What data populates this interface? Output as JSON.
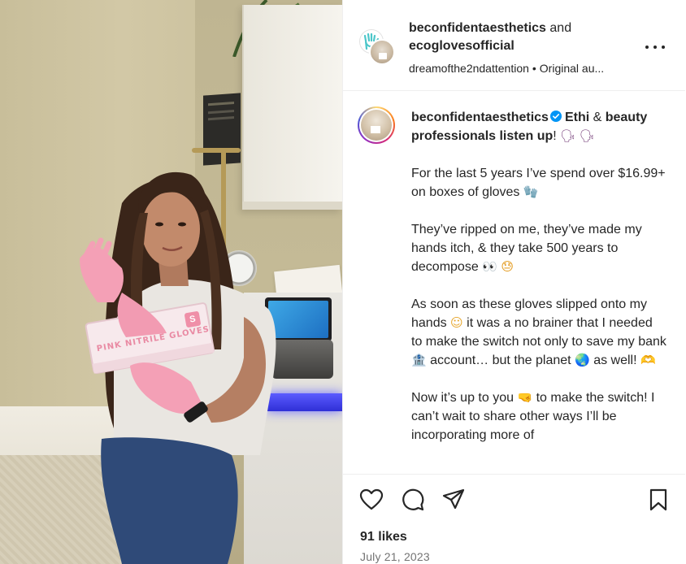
{
  "post": {
    "photo_alt": "Woman holding a box of pink nitrile gloves",
    "box_text": "PINK NITRILE GLOVES",
    "box_size": "S"
  },
  "header": {
    "author": "beconfidentaesthetics",
    "joiner": "and",
    "collaborator": "ecoglovesofficial",
    "audio_user": "dreamofthe2ndattention",
    "separator": "•",
    "audio_label": "Original au..."
  },
  "caption": {
    "username": "beconfidentaesthetics",
    "verified": true,
    "intro_bold": "Ethi",
    "intro_amp": " &",
    "intro_bold2": "beauty professionals listen up",
    "intro_end": "!",
    "emoji_speak": "🗣",
    "para1_a": "For the last 5 years I’ve spend over $16.99+ on boxes of gloves",
    "emoji_glove": "🧤",
    "para2_a": "They’ve ripped on me, they’ve made my hands itch, & they take 500 years to decompose",
    "emoji_eyes": "👀",
    "emoji_face": "😓",
    "para3_a": "As soon as these gloves slipped onto my hands",
    "emoji_smile": "☺",
    "para3_b": "it was a no brainer that I needed to make the switch not only to save my bank",
    "emoji_bank": "🏦",
    "para3_c": "account… but the planet",
    "emoji_globe": "🌏",
    "para3_d": "as well!",
    "emoji_heart": "🫶",
    "para4_a": "Now it’s up to you",
    "emoji_fist": "🤜",
    "para4_b": "to make the switch! I can’t wait to share other ways I’ll be incorporating more of"
  },
  "actions": {
    "like_icon": "heart-icon",
    "comment_icon": "comment-icon",
    "share_icon": "paper-plane-icon",
    "save_icon": "bookmark-icon"
  },
  "stats": {
    "likes": "91 likes",
    "date": "July 21, 2023"
  },
  "colors": {
    "text": "#262626",
    "muted": "#737373",
    "verified": "#0095f6",
    "border": "#efefef"
  }
}
